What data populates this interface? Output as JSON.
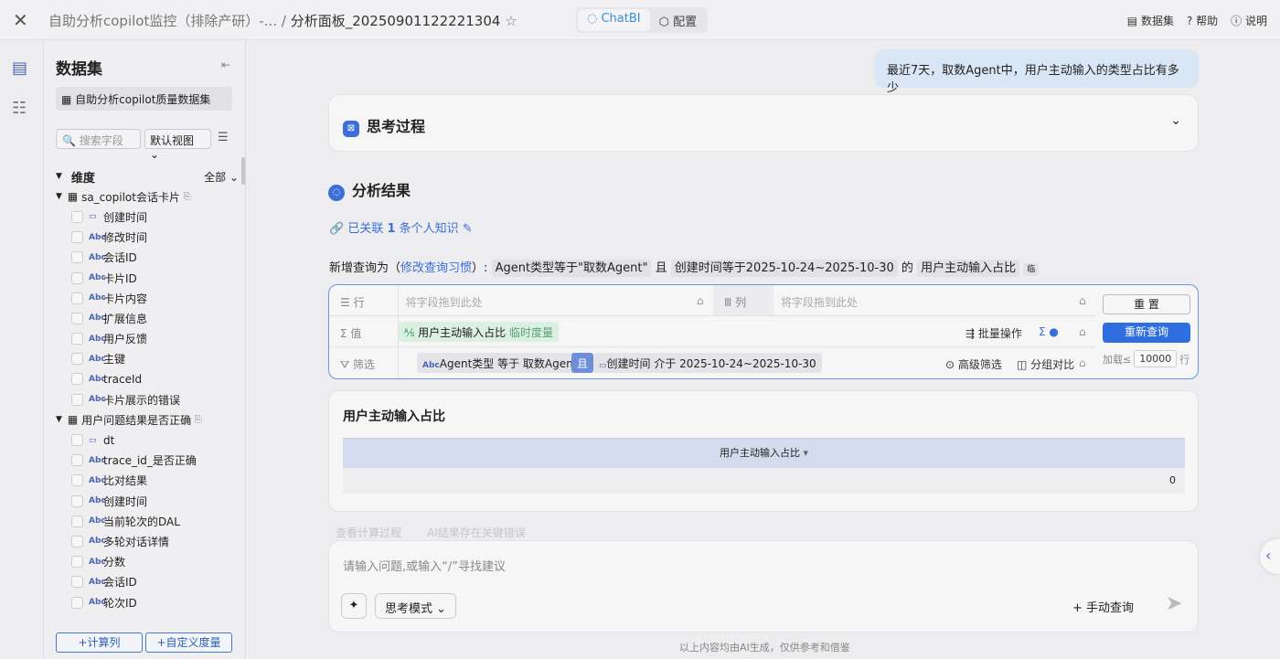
{
  "topbar": {
    "close_icon": "close-icon",
    "breadcrumb_parent": "自助分析copilot监控（排除产研）-...",
    "separator": "/",
    "title": "分析面板_20250901122221304",
    "star_icon": "star-icon",
    "modes": [
      "ChatBI",
      "配置"
    ],
    "active_mode": "ChatBI",
    "links": [
      "数据集",
      "帮助",
      "说明"
    ]
  },
  "sidebar": {
    "title": "数据集",
    "dataset": "自助分析copilot质量数据集",
    "search_placeholder": "搜索字段",
    "view": "默认视图",
    "dimension_label": "维度",
    "filter_all": "全部",
    "groups": [
      {
        "name": "sa_copilot会话卡片",
        "fields": [
          {
            "type": "date",
            "name": "创建时间"
          },
          {
            "type": "text",
            "name": "修改时间"
          },
          {
            "type": "text",
            "name": "会话ID"
          },
          {
            "type": "text",
            "name": "卡片ID"
          },
          {
            "type": "text",
            "name": "卡片内容"
          },
          {
            "type": "text",
            "name": "扩展信息"
          },
          {
            "type": "text",
            "name": "用户反馈"
          },
          {
            "type": "text",
            "name": "主键"
          },
          {
            "type": "text",
            "name": "traceId"
          },
          {
            "type": "text",
            "name": "卡片展示的错误"
          }
        ]
      },
      {
        "name": "用户问题结果是否正确",
        "fields": [
          {
            "type": "date",
            "name": "dt"
          },
          {
            "type": "text",
            "name": "trace_id_是否正确"
          },
          {
            "type": "text",
            "name": "比对结果"
          },
          {
            "type": "text",
            "name": "创建时间"
          },
          {
            "type": "text",
            "name": "当前轮次的DAL"
          },
          {
            "type": "text",
            "name": "多轮对话详情"
          },
          {
            "type": "text",
            "name": "分数"
          },
          {
            "type": "text",
            "name": "会话ID"
          },
          {
            "type": "text",
            "name": "轮次ID"
          }
        ]
      }
    ],
    "add_calc": "+计算列",
    "add_measure": "+自定义度量"
  },
  "chat": {
    "user_message": "最近7天，取数Agent中，用户主动输入的类型占比有多少",
    "thinking_title": "思考过程",
    "result_title": "分析结果",
    "linked_prefix": "已关联",
    "linked_count": "1",
    "linked_suffix": "条个人知识",
    "query_prefix": "新增查询为（",
    "query_link": "修改查询习惯",
    "query_suffix": "）:",
    "query_cond1": "Agent类型等于\"取数Agent\"",
    "and": "且",
    "query_cond2": "创建时间等于2025-10-24~2025-10-30",
    "of": "的",
    "query_measure": "用户主动输入占比",
    "temp_badge": "临"
  },
  "query": {
    "row_label": "行",
    "col_label": "列",
    "value_label": "值",
    "filter_label": "筛选",
    "drop_placeholder": "将字段拖到此处",
    "measure": "用户主动输入占比",
    "measure_tag": "临时度量",
    "batch": "批量操作",
    "filter1": "Agent类型 等于 取数Agent",
    "and": "且",
    "filter2": "创建时间 介于 2025-10-24~2025-10-30",
    "advanced": "高级筛选",
    "group_compare": "分组对比",
    "reset": "重 置",
    "requery": "重新查询",
    "load_prefix": "加载≤",
    "load_value": "10000",
    "load_suffix": "行"
  },
  "result_table": {
    "title": "用户主动输入占比",
    "header": "用户主动输入占比",
    "value": "0"
  },
  "faded_actions": [
    "查看计算过程",
    "AI结果存在关键错误"
  ],
  "input": {
    "placeholder": "请输入问题,或输入“/”寻找建议",
    "mode": "思考模式",
    "manual": "+ 手动查询"
  },
  "footer": "以上内容均由AI生成，仅供参考和借鉴",
  "colors": {
    "accent": "#3a6fd8",
    "bubble": "#d9e6f5"
  }
}
